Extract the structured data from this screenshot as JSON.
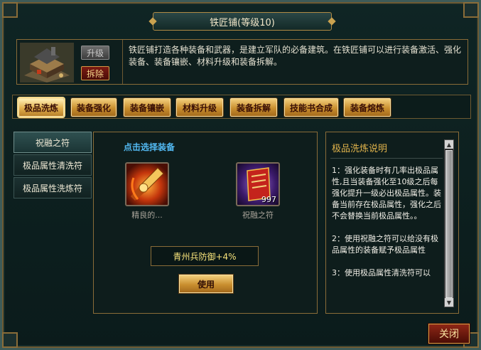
{
  "window": {
    "title": "铁匠铺(等级10)"
  },
  "building": {
    "upgrade_label": "升级",
    "dismantle_label": "拆除",
    "description": "铁匠铺打造各种装备和武器，是建立军队的必备建筑。在铁匠铺可以进行装备激活、强化装备、装备镶嵌、材料升级和装备拆解。"
  },
  "functions": [
    {
      "label": "极品洗炼"
    },
    {
      "label": "装备强化"
    },
    {
      "label": "装备镶嵌"
    },
    {
      "label": "材料升级"
    },
    {
      "label": "装备拆解"
    },
    {
      "label": "技能书合成"
    },
    {
      "label": "装备熔炼"
    }
  ],
  "side_list": [
    {
      "label": "祝融之符"
    },
    {
      "label": "极品属性清洗符"
    },
    {
      "label": "极品属性洗炼符"
    }
  ],
  "center": {
    "hint": "点击选择装备",
    "equipment_caption": "精良的...",
    "item_caption": "祝融之符",
    "item_count": "997",
    "result": "青州兵防御+4%",
    "use_label": "使用"
  },
  "description": {
    "title": "极品洗炼说明",
    "paragraphs": [
      "1：强化装备时有几率出极品属性,且当装备强化至10级之后每强化提升一级必出极品属性。装备当前存在极品属性，强化之后不会替换当前极品属性。。",
      "2：使用祝融之符可以给没有极品属性的装备赋予极品属性",
      "3：使用极品属性清洗符可以"
    ]
  },
  "close_label": "关闭",
  "colors": {
    "gold": "#caa24f",
    "hint_blue": "#52b9f2",
    "result_yellow": "#f6e27a"
  }
}
